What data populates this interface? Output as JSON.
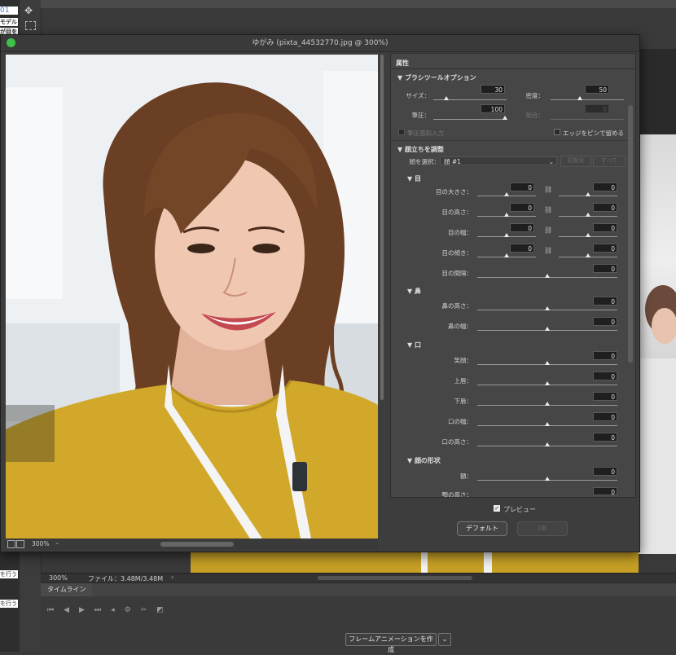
{
  "dialog": {
    "title": "ゆがみ (pixta_44532770.jpg @ 300%)",
    "zoom_footer": "300%",
    "preview_label": "プレビュー",
    "default_button": "デフォルト",
    "ok_button": "OK"
  },
  "properties": {
    "header": "属性",
    "brush": {
      "title": "ブラシツールオプション",
      "size_label": "サイズ：",
      "size": "30",
      "density_label": "密度：",
      "density": "50",
      "pressure_label": "筆圧：",
      "pressure": "100",
      "rate_label": "割合：",
      "rate": "0",
      "stylus_label": "筆圧感知入力",
      "pin_edges_label": "エッジをピンで留める"
    },
    "face": {
      "title": "顔立ちを調整",
      "select_label": "顔を選択：",
      "select_value": "顔 #1",
      "reset_button": "初期化",
      "all_button": "すべて",
      "eyes": {
        "title": "目",
        "rows": [
          {
            "label": "目の大きさ：",
            "left": "0",
            "right": "0",
            "linked": true
          },
          {
            "label": "目の高さ：",
            "left": "0",
            "right": "0",
            "linked": true
          },
          {
            "label": "目の幅：",
            "left": "0",
            "right": "0",
            "linked": true
          },
          {
            "label": "目の傾き：",
            "left": "0",
            "right": "0",
            "linked": true
          },
          {
            "label": "目の間隔：",
            "value": "0"
          }
        ]
      },
      "nose": {
        "title": "鼻",
        "rows": [
          {
            "label": "鼻の高さ：",
            "value": "0"
          },
          {
            "label": "鼻の幅：",
            "value": "0"
          }
        ]
      },
      "mouth": {
        "title": "口",
        "rows": [
          {
            "label": "笑顔：",
            "value": "0"
          },
          {
            "label": "上唇：",
            "value": "0"
          },
          {
            "label": "下唇：",
            "value": "0"
          },
          {
            "label": "口の幅：",
            "value": "0"
          },
          {
            "label": "口の高さ：",
            "value": "0"
          }
        ]
      },
      "face_shape": {
        "title": "顔の形状",
        "rows": [
          {
            "label": "額：",
            "value": "0"
          },
          {
            "label": "顎の高さ：",
            "value": "0"
          }
        ]
      }
    }
  },
  "background": {
    "status_zoom": "300%",
    "status_file": "ファイル：3.48M/3.48M",
    "timeline_tab": "タイムライン",
    "create_anim_button": "フレームアニメーションを作成",
    "doc_snippets": [
      "01",
      "モデル",
      "が目を",
      "を行う",
      "を行う"
    ]
  }
}
